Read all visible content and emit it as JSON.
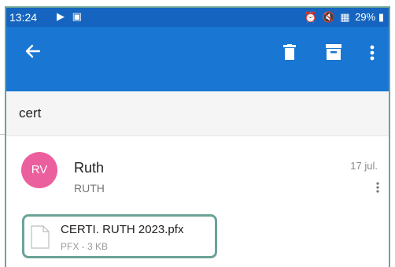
{
  "status_bar": {
    "time": "13:24",
    "battery": "29%",
    "background": "#1565c0"
  },
  "toolbar": {
    "background": "#1976d2",
    "icons": [
      "back-arrow-icon",
      "trash-icon",
      "archive-icon",
      "more-vertical-icon"
    ]
  },
  "email": {
    "subject": "cert",
    "sender": {
      "initials": "RV",
      "name": "Ruth",
      "address": "RUTH",
      "avatar_color": "#ec5f9e"
    },
    "date": "17 jul.",
    "attachment": {
      "file_name": "CERTI. RUTH 2023.pfx",
      "meta": "PFX - 3 KB",
      "highlight_color": "#6ca398"
    }
  }
}
